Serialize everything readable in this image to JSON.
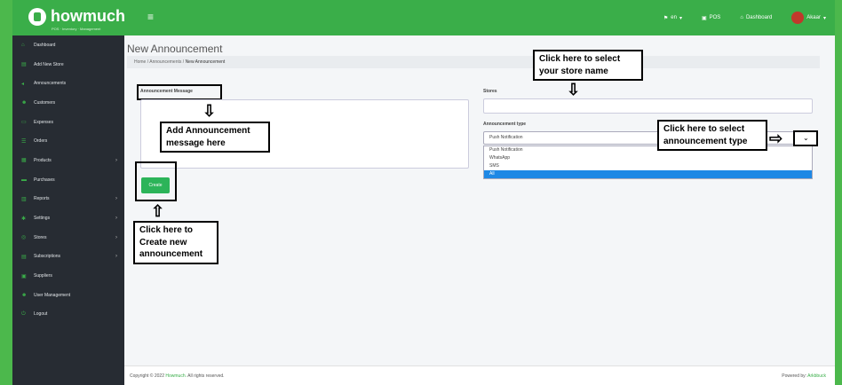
{
  "app": {
    "logo": "howmuch",
    "logo_sub": "POS · Inventory · Management"
  },
  "topbar": {
    "menu_icon": "≡",
    "lang": "en",
    "pos": "POS",
    "dashboard": "Dashboard",
    "user": "Akaar"
  },
  "sidebar": {
    "items": [
      {
        "label": "Dashboard",
        "icon": "home-icon"
      },
      {
        "label": "Add New Store",
        "icon": "store-icon"
      },
      {
        "label": "Announcements",
        "icon": "megaphone-icon"
      },
      {
        "label": "Customers",
        "icon": "users-icon"
      },
      {
        "label": "Expenses",
        "icon": "money-icon"
      },
      {
        "label": "Orders",
        "icon": "list-icon"
      },
      {
        "label": "Products",
        "icon": "box-icon",
        "arrow": true
      },
      {
        "label": "Purchases",
        "icon": "cart-icon"
      },
      {
        "label": "Reports",
        "icon": "chart-icon",
        "arrow": true
      },
      {
        "label": "Settings",
        "icon": "gear-icon",
        "arrow": true
      },
      {
        "label": "Stores",
        "icon": "store-icon",
        "arrow": true
      },
      {
        "label": "Subscriptions",
        "icon": "card-icon",
        "arrow": true
      },
      {
        "label": "Suppliers",
        "icon": "truck-icon"
      },
      {
        "label": "User Management",
        "icon": "user-icon"
      },
      {
        "label": "Logout",
        "icon": "power-icon"
      }
    ]
  },
  "page": {
    "title": "New Announcement",
    "breadcrumb": [
      "Home",
      "Announcements",
      "New Announcement"
    ]
  },
  "form": {
    "message_label": "Announcement Message",
    "stores_label": "Stores",
    "type_label": "Announcement type",
    "type_selected": "Push Notification",
    "type_options": [
      "Push Notification",
      "WhatsApp",
      "SMS",
      "All"
    ],
    "create_label": "Create"
  },
  "callouts": {
    "store": "Click here to select your store name",
    "message": "Add Announcement message here",
    "type": "Click here to select announcement type",
    "create": "Click here to Create new announcement"
  },
  "footer": {
    "copyright": "Copyright © 2022",
    "brand": "Howmuch.",
    "rights": "All rights reserved.",
    "powered": "Powered by:",
    "powered_brand": "Arkbbuck"
  }
}
